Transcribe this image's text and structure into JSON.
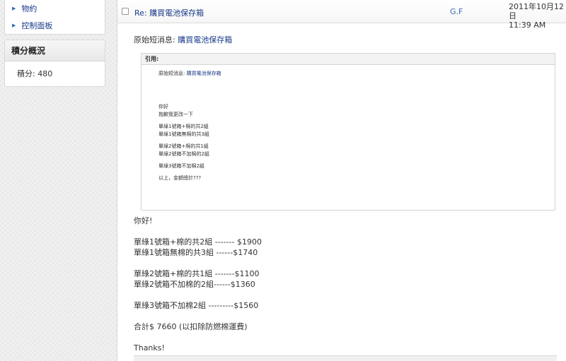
{
  "sidebar": {
    "links": [
      {
        "label": "物約",
        "icon": "triangle-right-icon"
      },
      {
        "label": "控制面板",
        "icon": "triangle-right-icon"
      }
    ],
    "stats": {
      "title": "積分概況",
      "points_label": "積分:",
      "points_value": "480"
    }
  },
  "message": {
    "subject": "Re: 購買電池保存箱",
    "sender": "G.F",
    "date": "2011年10月12日",
    "time": "11:39 AM",
    "original_prefix": "原始短消息:",
    "original_title": "購買電池保存箱",
    "quote": {
      "header": "引用:",
      "prefix": "原始短消息:",
      "title": "購買電池保存箱",
      "lines": [
        "你好",
        "抱歉我更改一下",
        "",
        "單綠1號箱+棉的共2組",
        "單綠1號箱無棉的共3組",
        "",
        "單綠2號箱+棉的共1組",
        "單綠2號箱不加棉的2組",
        "",
        "單綠3號箱不加棉2組",
        "",
        "以上，金額總計???"
      ]
    },
    "reply": {
      "greeting": "你好!",
      "lines": [
        "單綠1號箱+棉的共2組 ------- $1900",
        "單綠1號箱無棉的共3組 ------$1740",
        "",
        "單綠2號箱+棉的共1組 -------$1100",
        "單綠2號箱不加棉的2組------$1360",
        "",
        "單綠3號箱不加棉2組 ---------$1560",
        "",
        "合計$ 7660 (以扣除防燃棉運費)",
        "",
        "Thanks!"
      ]
    }
  },
  "colors": {
    "link": "#1a3a8a",
    "sender": "#3a6ab8",
    "background": "#f1f1f1"
  }
}
